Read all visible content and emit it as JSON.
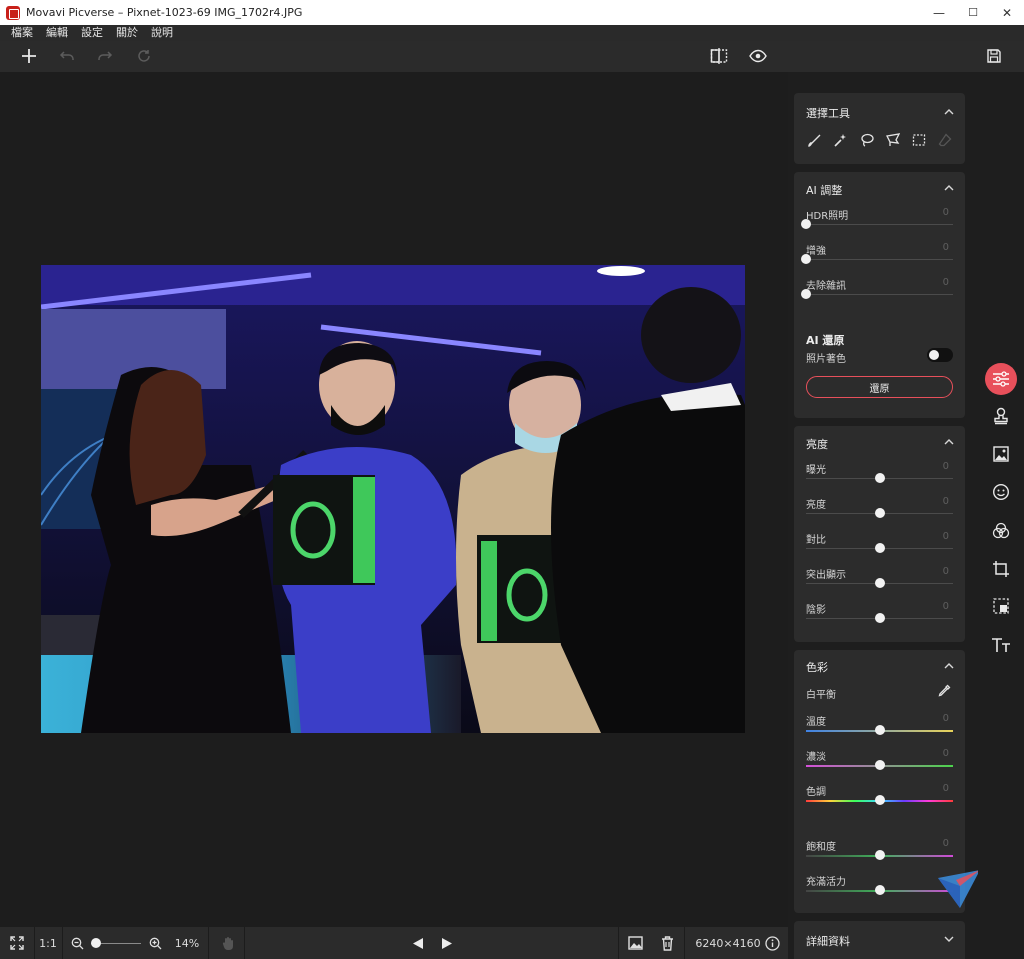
{
  "window": {
    "title": "Movavi Picverse – Pixnet-1023-69 IMG_1702r4.JPG",
    "minimize": "—",
    "maximize": "☐",
    "close": "✕"
  },
  "menu": [
    "檔案",
    "編輯",
    "設定",
    "關於",
    "說明"
  ],
  "toolbar": {
    "left_icons": [
      "plus-icon",
      "undo-icon",
      "redo-icon",
      "reset-icon"
    ],
    "right_icons": [
      "compare-icon",
      "eye-icon",
      "save-icon"
    ]
  },
  "bottom": {
    "one_to_one": "1:1",
    "zoom": "14%",
    "zoom_fraction": 0.1,
    "dimensions": "6240×4160"
  },
  "panel": {
    "selection": {
      "title": "選擇工具"
    },
    "ai_adjust": {
      "title": "AI 調整",
      "sliders": [
        {
          "label": "HDR照明",
          "value": "0",
          "level": 0
        },
        {
          "label": "增強",
          "value": "0",
          "level": 0
        },
        {
          "label": "去除雜訊",
          "value": "0",
          "level": 0
        }
      ],
      "restore_title": "AI 還原",
      "colorize_label": "照片著色",
      "colorize_on": false,
      "restore_button": "還原"
    },
    "brightness": {
      "title": "亮度",
      "sliders": [
        {
          "label": "曝光",
          "value": "0",
          "level": 0.5
        },
        {
          "label": "亮度",
          "value": "0",
          "level": 0.5
        },
        {
          "label": "對比",
          "value": "0",
          "level": 0.5
        },
        {
          "label": "突出顯示",
          "value": "0",
          "level": 0.5
        },
        {
          "label": "陰影",
          "value": "0",
          "level": 0.5
        }
      ]
    },
    "color": {
      "title": "色彩",
      "white_balance": "白平衡",
      "sliders": [
        {
          "label": "溫度",
          "value": "0",
          "level": 0.5
        },
        {
          "label": "濃淡",
          "value": "0",
          "level": 0.5
        },
        {
          "label": "色調",
          "value": "0",
          "level": 0.5
        },
        {
          "label": "飽和度",
          "value": "0",
          "level": 0.5
        },
        {
          "label": "充滿活力",
          "value": "",
          "level": 0.5
        }
      ]
    },
    "details": {
      "title": "詳細資料"
    }
  },
  "rail": {
    "icons": [
      "adjust-icon",
      "stamp-icon",
      "image-icon",
      "face-icon",
      "color-mix-icon",
      "crop-icon",
      "select-icon",
      "text-icon"
    ],
    "active": "adjust-icon",
    "accent": "#e8505b"
  },
  "photo": {
    "description_colors": {
      "bg": "#0f0d2a",
      "neon": "#6a63ff"
    }
  }
}
